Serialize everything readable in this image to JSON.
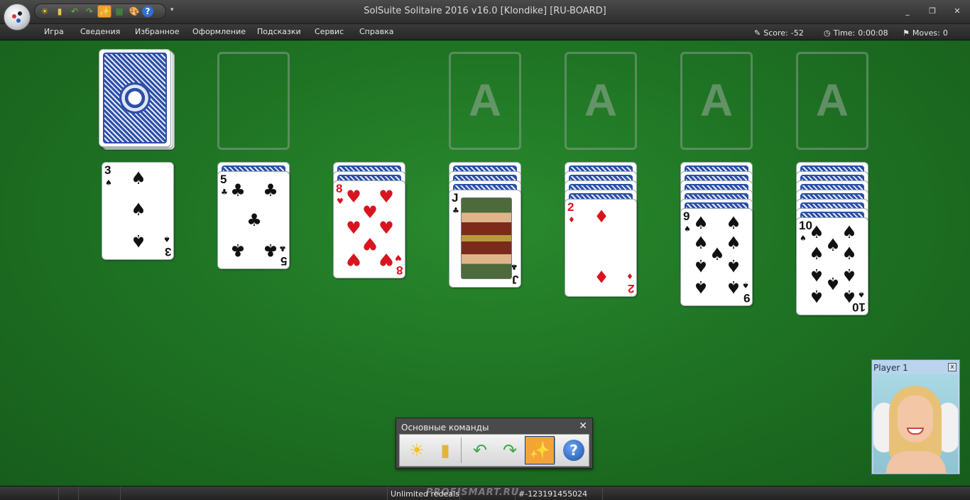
{
  "window": {
    "title": "SolSuite Solitaire 2016 v16.0  [Klondike]  [RU-BOARD]",
    "minimize": "_",
    "restore": "❐",
    "close": "✕"
  },
  "quick_access": {
    "icons": [
      "sun-icon",
      "folder-icon",
      "undo-icon",
      "redo-icon",
      "magic-wand-icon",
      "stats-icon",
      "palette-icon",
      "help-icon"
    ],
    "glyphs": [
      "☀",
      "▮",
      "↶",
      "↷",
      "✨",
      "▦",
      "🎨",
      "?"
    ],
    "more": "▾"
  },
  "menu": {
    "items": [
      "Игра",
      "Сведения",
      "Избранное",
      "Оформление",
      "Подсказки",
      "Сервис",
      "Справка"
    ]
  },
  "stats": {
    "score_label": "Score:",
    "score_value": "-52",
    "time_label": "Time:",
    "time_value": "0:00:08",
    "moves_label": "Moves:",
    "moves_value": "0"
  },
  "foundations": {
    "placeholder": [
      "A",
      "A",
      "A",
      "A"
    ]
  },
  "tableau": {
    "columns": [
      {
        "face_down": 0,
        "rank": "3",
        "suit": "♠",
        "color": "black"
      },
      {
        "face_down": 1,
        "rank": "5",
        "suit": "♣",
        "color": "black"
      },
      {
        "face_down": 2,
        "rank": "8",
        "suit": "♥",
        "color": "red"
      },
      {
        "face_down": 3,
        "rank": "J",
        "suit": "♣",
        "color": "black"
      },
      {
        "face_down": 4,
        "rank": "2",
        "suit": "♦",
        "color": "red"
      },
      {
        "face_down": 5,
        "rank": "9",
        "suit": "♠",
        "color": "black"
      },
      {
        "face_down": 6,
        "rank": "10",
        "suit": "♠",
        "color": "black"
      }
    ]
  },
  "command_panel": {
    "title": "Основные команды",
    "close": "✕",
    "buttons": [
      {
        "name": "new-game-button",
        "icon": "sun-icon",
        "glyph": "☀",
        "active": false
      },
      {
        "name": "open-button",
        "icon": "folder-icon",
        "glyph": "▮",
        "active": false
      },
      {
        "name": "undo-button",
        "icon": "undo-arrow-icon",
        "glyph": "↶",
        "active": false
      },
      {
        "name": "redo-button",
        "icon": "redo-arrow-icon",
        "glyph": "↷",
        "active": false
      },
      {
        "name": "hint-button",
        "icon": "magic-wand-icon",
        "glyph": "✨",
        "active": true
      },
      {
        "name": "help-button",
        "icon": "help-icon",
        "glyph": "?",
        "active": false
      }
    ]
  },
  "player": {
    "name": "Player 1",
    "close": "x"
  },
  "status": {
    "redeals": "Unlimited redeals",
    "game_number": "#-123191455024",
    "watermark": "PROFISMART.RU"
  }
}
